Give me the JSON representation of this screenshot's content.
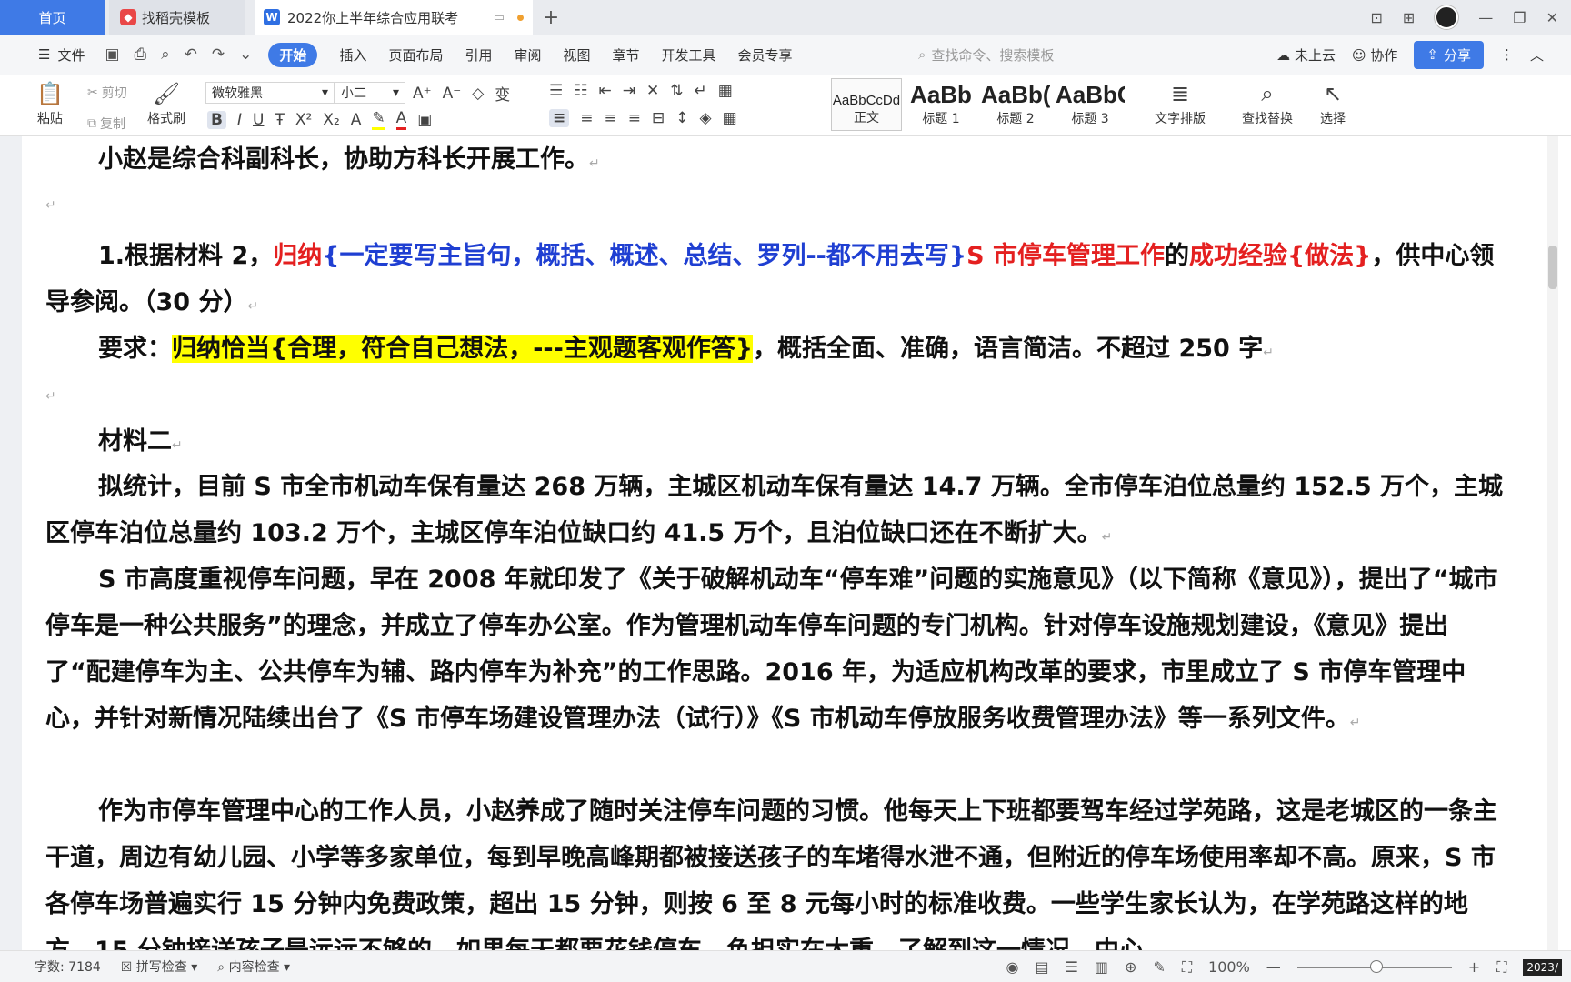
{
  "tabs": {
    "home": "首页",
    "template": "找稻壳模板",
    "document": "2022你上半年综合应用联考",
    "add": "+"
  },
  "menu": {
    "file": "文件",
    "items": [
      "开始",
      "插入",
      "页面布局",
      "引用",
      "审阅",
      "视图",
      "章节",
      "开发工具",
      "会员专享"
    ],
    "search_placeholder": "查找命令、搜索模板",
    "cloud": "未上云",
    "collab": "协作",
    "share": "分享"
  },
  "ribbon": {
    "paste": "粘贴",
    "cut": "剪切",
    "copy": "复制",
    "format_painter": "格式刷",
    "font_name": "微软雅黑",
    "font_size": "小二",
    "styles": [
      {
        "preview": "AaBbCcDd",
        "label": "正文"
      },
      {
        "preview": "AaBb",
        "label": "标题 1"
      },
      {
        "preview": "AaBb(",
        "label": "标题 2"
      },
      {
        "preview": "AaBbC",
        "label": "标题 3"
      }
    ],
    "text_layout": "文字排版",
    "find_replace": "查找替换",
    "select": "选择"
  },
  "document": {
    "p1": "小赵是综合科副科长，协助方科长开展工作。",
    "q1": {
      "prefix": "1.根据材料 2，",
      "r1": "归纳",
      "b1": "{一定要写主旨句，概括、概述、总结、罗列--都不用去写}",
      "r2": "S 市停车管理工作",
      "t1": "的",
      "r3": "成功经验{做法}",
      "t2": "，供中心领导参阅。（30 分）"
    },
    "req": {
      "prefix": "要求：",
      "highlight": "归纳恰当{合理，符合自己想法，---主观题客观作答}",
      "rest": "，概括全面、准确，语言简洁。不超过 250 字"
    },
    "material_title": "材料二",
    "m1": "拟统计，目前 S 市全市机动车保有量达 268 万辆，主城区机动车保有量达 14.7 万辆。全市停车泊位总量约 152.5 万个，主城区停车泊位总量约 103.2 万个，主城区停车泊位缺口约 41.5 万个，且泊位缺口还在不断扩大。",
    "m2": "S 市高度重视停车问题，早在 2008 年就印发了《关于破解机动车“停车难”问题的实施意见》（以下简称《意见》），提出了“城市停车是一种公共服务”的理念，并成立了停车办公室。作为管理机动车停车问题的专门机构。针对停车设施规划建设，《意见》提出了“配建停车为主、公共停车为辅、路内停车为补充”的工作思路。2016 年，为适应机构改革的要求，市里成立了 S 市停车管理中心，并针对新情况陆续出台了《S 市停车场建设管理办法（试行）》《S 市机动车停放服务收费管理办法》等一系列文件。",
    "m3": "作为市停车管理中心的工作人员，小赵养成了随时关注停车问题的习惯。他每天上下班都要驾车经过学苑路，这是老城区的一条主干道，周边有幼儿园、小学等多家单位，每到早晚高峰期都被接送孩子的车堵得水泄不通，但附近的停车场使用率却不高。原来，S 市各停车场普遍实行 15 分钟内免费政策，超出 15 分钟，则按 6 至 8 元每小时的标准收费。一些学生家长认为，在学苑路这样的地方，15 分钟接送孩子是远远不够的，如果每天都要花钱停车，负担实在太重。了解到这一情况，中心"
  },
  "status": {
    "word_count": "字数: 7184",
    "spell_check": "拼写检查",
    "content_check": "内容检查",
    "zoom": "100%",
    "clock": "2023/"
  },
  "colors": {
    "accent": "#3f7ae6",
    "red_text": "#e42020",
    "blue_text": "#1f3fd2",
    "highlight": "#ffff00"
  }
}
